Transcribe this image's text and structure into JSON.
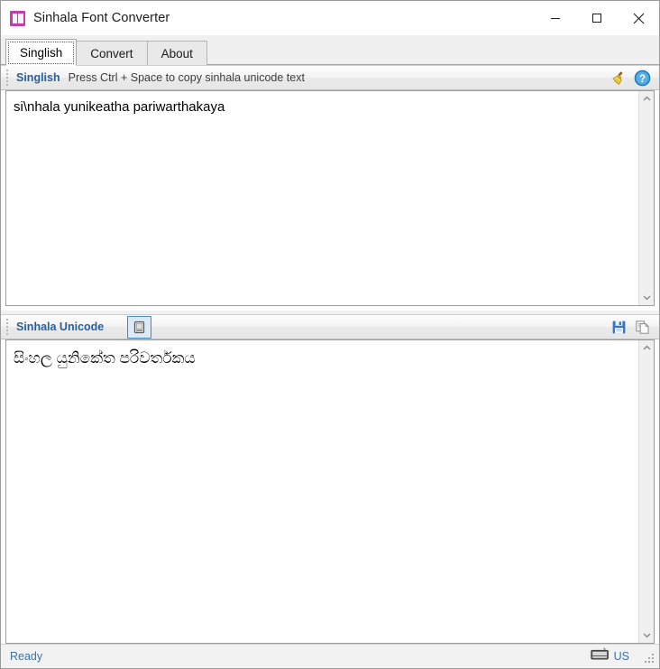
{
  "window": {
    "title": "Sinhala Font Converter",
    "icon": "app-icon",
    "controls": {
      "minimize": "minimize-button",
      "maximize": "maximize-button",
      "close": "close-button"
    }
  },
  "tabs": [
    {
      "label": "Singlish",
      "selected": true
    },
    {
      "label": "Convert",
      "selected": false
    },
    {
      "label": "About",
      "selected": false
    }
  ],
  "singlish_panel": {
    "toolbar": {
      "label": "Singlish",
      "hint": "Press Ctrl + Space to copy sinhala unicode text",
      "clear_button": "broom-icon",
      "help_button": "help-icon"
    },
    "text": "si\\nhala yunikeatha pariwarthakaya"
  },
  "unicode_panel": {
    "toolbar": {
      "label": "Sinhala Unicode",
      "view_button": "monitor-icon",
      "save_button": "save-icon",
      "copy_button": "copy-icon"
    },
    "text": "සිංහල යුනිකේත පරිවර්තකය"
  },
  "statusbar": {
    "status": "Ready",
    "keyboard_icon": "keyboard-icon",
    "keyboard_layout": "US"
  },
  "colors": {
    "accent_blue": "#2a6099",
    "status_blue": "#3b73a8",
    "app_icon": "#bf3fb0",
    "toggled_border": "#3c8dc5",
    "save_blue": "#3a74c4"
  }
}
